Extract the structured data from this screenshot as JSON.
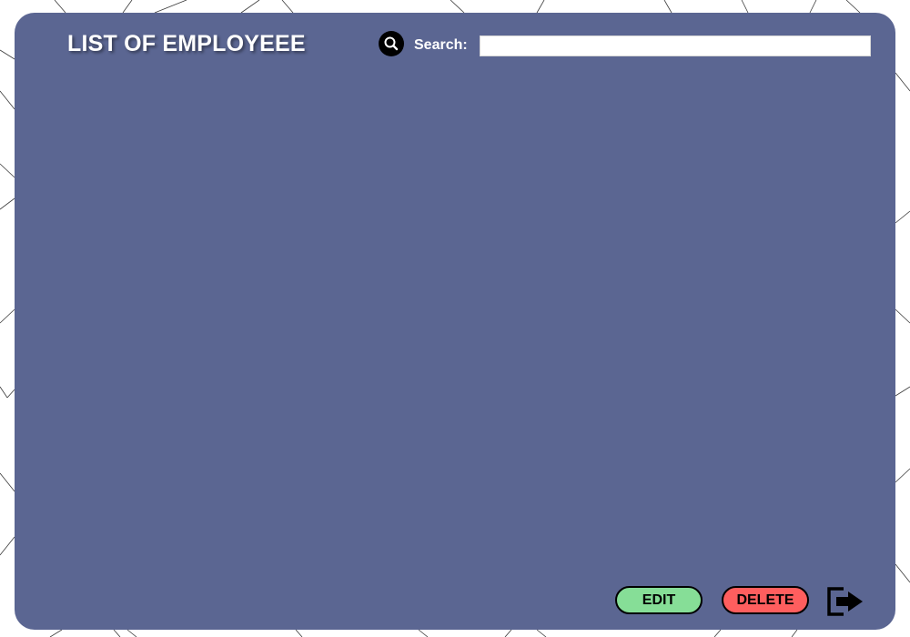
{
  "header": {
    "title": "LIST OF EMPLOYEEE",
    "search_icon": "search-icon",
    "search_label": "Search:",
    "search_value": "",
    "search_placeholder": ""
  },
  "actions": {
    "edit_label": "EDIT",
    "delete_label": "DELETE",
    "exit_icon": "exit-icon"
  },
  "colors": {
    "panel": "#5b6692",
    "edit": "#86de97",
    "delete": "#ff5e5e"
  }
}
